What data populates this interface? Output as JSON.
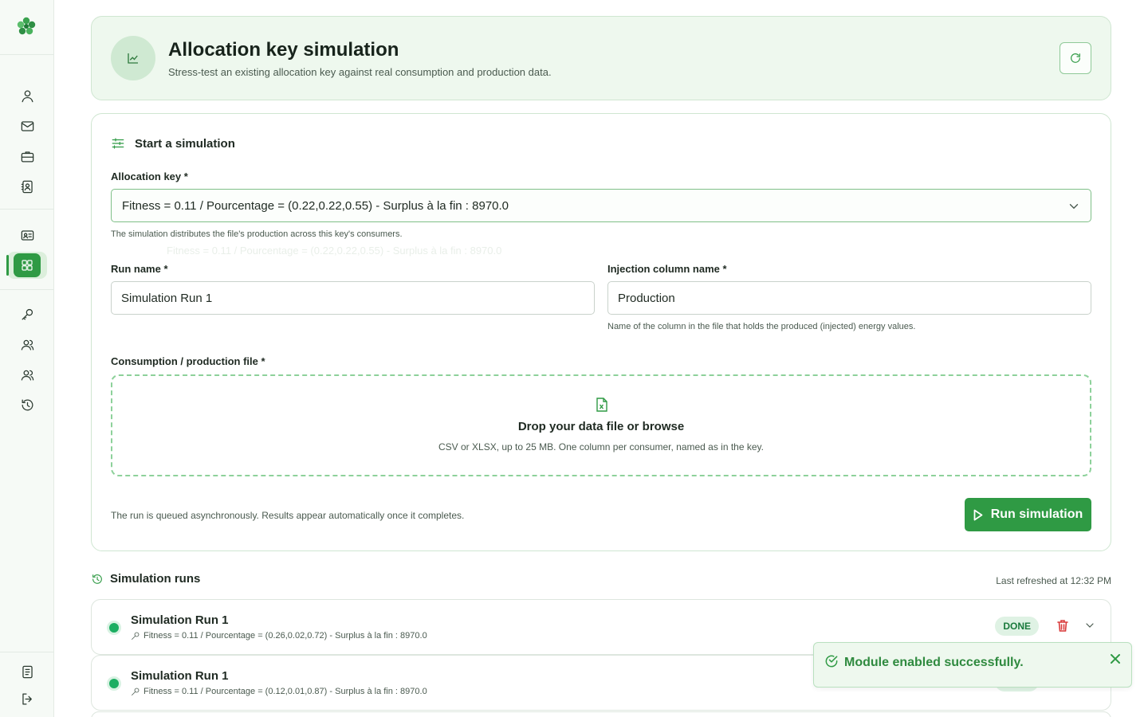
{
  "sidebar": {
    "logo_icon": "leaf-cluster-logo",
    "items": [
      {
        "icon": "user-icon",
        "name": "sidebar-item-profile"
      },
      {
        "icon": "mail-icon",
        "name": "sidebar-item-messages"
      },
      {
        "icon": "briefcase-icon",
        "name": "sidebar-item-projects"
      },
      {
        "icon": "contact-book-icon",
        "name": "sidebar-item-contacts"
      },
      {
        "icon": "id-card-icon",
        "name": "sidebar-item-members"
      },
      {
        "icon": "grid-icon",
        "name": "sidebar-item-modules",
        "active": true
      },
      {
        "icon": "key-icon",
        "name": "sidebar-item-keys"
      },
      {
        "icon": "users-icon",
        "name": "sidebar-item-communities"
      },
      {
        "icon": "users-alt-icon",
        "name": "sidebar-item-participants"
      },
      {
        "icon": "history-icon",
        "name": "sidebar-item-history"
      },
      {
        "icon": "document-icon",
        "name": "sidebar-item-documents"
      },
      {
        "icon": "logout-icon",
        "name": "sidebar-item-logout"
      }
    ]
  },
  "header": {
    "title": "Allocation key simulation",
    "subtitle": "Stress-test an existing allocation key against real consumption and production data.",
    "icon": "chart-icon",
    "refresh_icon": "refresh-icon"
  },
  "form": {
    "section_title": "Start a simulation",
    "allocation_key": {
      "label": "Allocation key *",
      "value": "Fitness = 0.11 / Pourcentage = (0.22,0.22,0.55) - Surplus à la fin : 8970.0",
      "hint": "The simulation distributes the file's production across this key's consumers."
    },
    "run_name": {
      "label": "Run name *",
      "value": "Simulation Run 1"
    },
    "injection_column": {
      "label": "Injection column name *",
      "value": "Production",
      "hint": "Name of the column in the file that holds the produced (injected) energy values."
    },
    "file": {
      "label": "Consumption / production file *",
      "title": "Drop your data file or browse",
      "subtitle": "CSV or XLSX, up to 25 MB. One column per consumer, named as in the key.",
      "icon": "spreadsheet-file-icon"
    },
    "footer_note": "The run is queued asynchronously. Results appear automatically once it completes.",
    "submit_label": "Run simulation"
  },
  "runs": {
    "title": "Simulation runs",
    "last_refreshed": "Last refreshed at 12:32 PM",
    "items": [
      {
        "name": "Simulation Run 1",
        "key": "Fitness = 0.11 / Pourcentage = (0.26,0.02,0.72) - Surplus à la fin : 8970.0",
        "status": "DONE"
      },
      {
        "name": "Simulation Run 1",
        "key": "Fitness = 0.11 / Pourcentage = (0.12,0.01,0.87) - Surplus à la fin : 8970.0",
        "status": "DONE"
      }
    ]
  },
  "toast": {
    "message": "Module enabled successfully."
  },
  "colors": {
    "accent": "#2f9a44",
    "header_bg": "#eef8ee",
    "status_done": "#1cae62",
    "danger": "#d93b3b"
  }
}
